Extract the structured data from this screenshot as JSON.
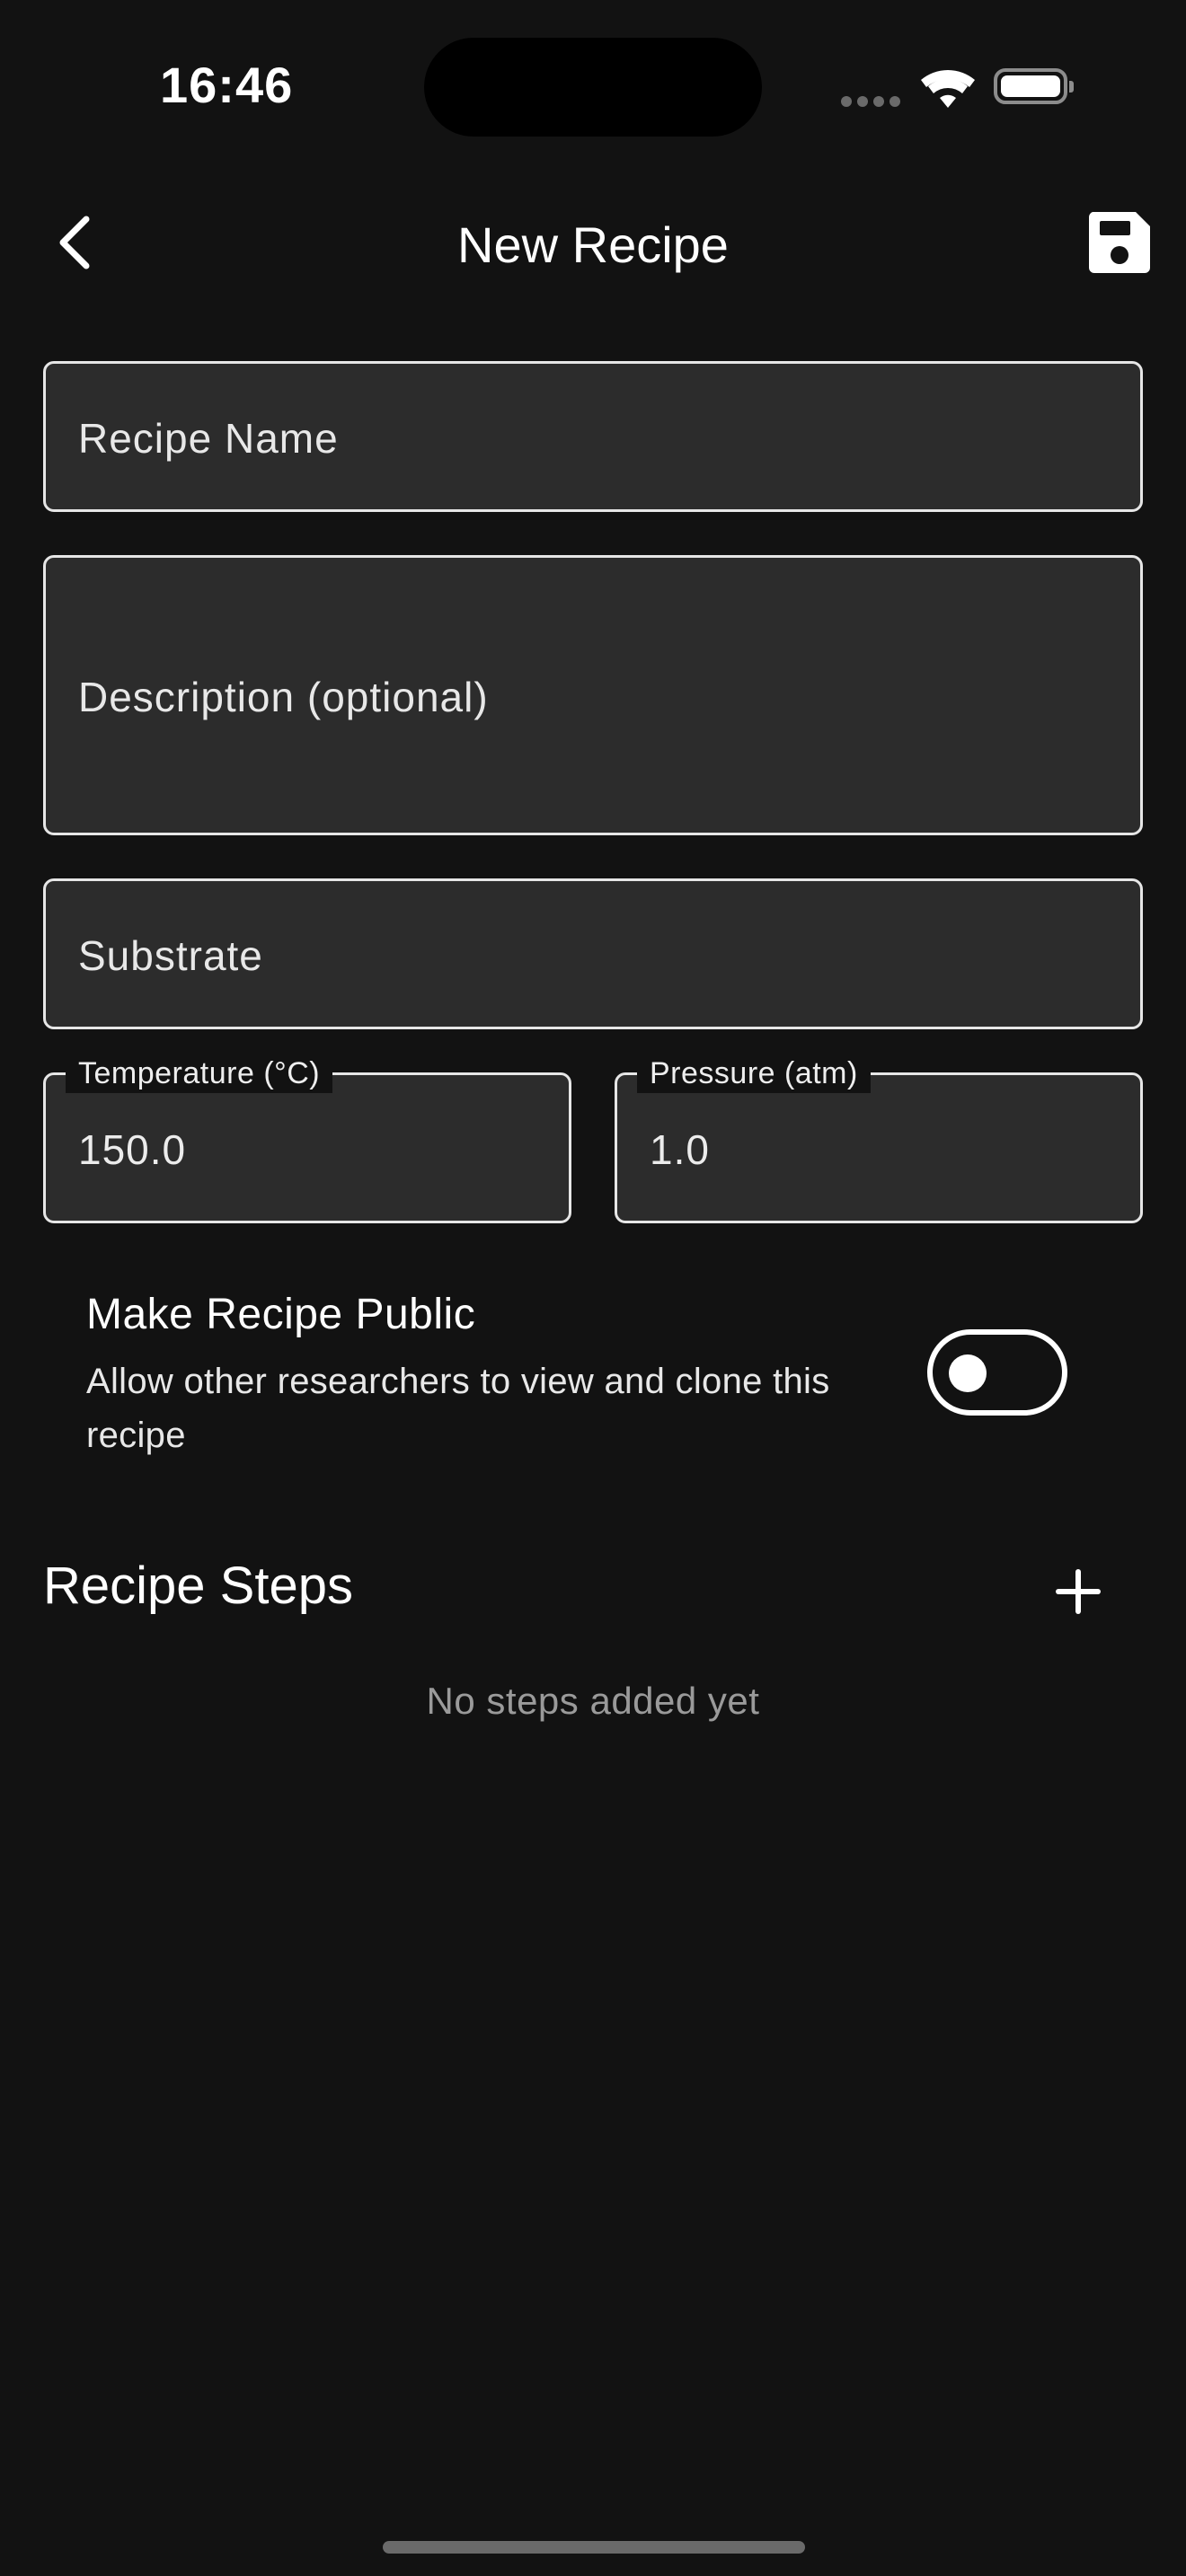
{
  "status_bar": {
    "time": "16:46"
  },
  "header": {
    "title": "New Recipe",
    "back_icon": "chevron-left-icon",
    "save_icon": "floppy-disk-icon"
  },
  "form": {
    "recipe_name": {
      "value": "",
      "placeholder": "Recipe Name"
    },
    "description": {
      "value": "",
      "placeholder": "Description (optional)"
    },
    "substrate": {
      "value": "",
      "placeholder": "Substrate"
    },
    "temperature": {
      "label": "Temperature (°C)",
      "value": "150.0"
    },
    "pressure": {
      "label": "Pressure (atm)",
      "value": "1.0"
    }
  },
  "public_toggle": {
    "title": "Make Recipe Public",
    "description": "Allow other researchers to view and clone this recipe",
    "enabled": false
  },
  "steps": {
    "title": "Recipe Steps",
    "add_icon": "plus-icon",
    "empty_text": "No steps added yet"
  },
  "colors": {
    "background": "#121212",
    "field_background": "#2c2c2c",
    "field_border": "#e6e6e6",
    "muted_text": "#9a9a9a"
  }
}
